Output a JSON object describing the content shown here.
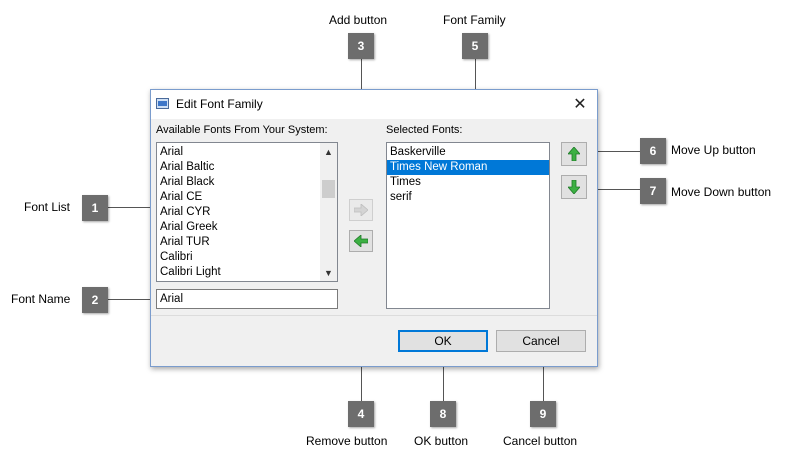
{
  "callouts": {
    "add_button": "Add  button",
    "font_family": "Font Family",
    "move_up": "Move Up  button",
    "move_down": "Move Down  button",
    "font_list": "Font List",
    "font_name": "Font Name",
    "remove_button": "Remove  button",
    "ok_button": "OK button",
    "cancel_button": "Cancel button",
    "badges": [
      "1",
      "2",
      "3",
      "4",
      "5",
      "6",
      "7",
      "8",
      "9"
    ]
  },
  "dialog": {
    "title": "Edit Font Family",
    "available_label": "Available Fonts From Your System:",
    "selected_label": "Selected Fonts:",
    "available_fonts": [
      "Arial",
      "Arial Baltic",
      "Arial Black",
      "Arial CE",
      "Arial CYR",
      "Arial Greek",
      "Arial TUR",
      "Calibri",
      "Calibri Light"
    ],
    "selected_fonts": [
      "Baskerville",
      "Times New Roman",
      "Times",
      "serif"
    ],
    "selected_index": 1,
    "font_name_value": "Arial",
    "ok_label": "OK",
    "cancel_label": "Cancel"
  },
  "colors": {
    "selection": "#0078d7",
    "badge": "#6d6d6d",
    "arrow_green": "#3cb043"
  }
}
